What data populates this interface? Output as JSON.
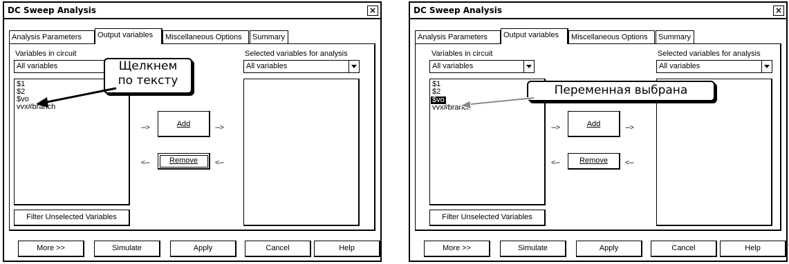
{
  "left_dialog": {
    "title": "DC Sweep Analysis",
    "close": "×",
    "tabs": [
      "Analysis Parameters",
      "Output variables",
      "Miscellaneous Options",
      "Summary"
    ],
    "variables_label": "Variables in circuit",
    "variables_filter": "All variables",
    "variables_list": [
      "$1",
      "$2",
      "$vo",
      "vvx#branch"
    ],
    "selected_label": "Selected variables for analysis",
    "selected_filter": "All variables",
    "add_arrow_left": "--->",
    "add_label": "Add",
    "add_arrow_right": "--->",
    "remove_arrow_left": "<---",
    "remove_label": "Remove",
    "remove_arrow_right": "<---",
    "filter_button": "Filter Unselected Variables",
    "footer_buttons": [
      "More >>",
      "Simulate",
      "Apply",
      "Cancel",
      "Help"
    ],
    "callout": [
      "Щелкнем",
      "по тексту"
    ]
  },
  "right_dialog": {
    "title": "DC Sweep Analysis",
    "close": "×",
    "tabs": [
      "Analysis Parameters",
      "Output variables",
      "Miscellaneous Options",
      "Summary"
    ],
    "variables_label": "Variables in circuit",
    "variables_filter": "All variables",
    "variables_list": [
      "$1",
      "$2",
      "$vo",
      "vvx#branch"
    ],
    "selected_item": "$vo",
    "selected_label": "Selected variables for analysis",
    "selected_filter": "All variables",
    "add_arrow_left": "--->",
    "add_label": "Add",
    "add_arrow_right": "--->",
    "remove_arrow_left": "<---",
    "remove_label": "Remove",
    "remove_arrow_right": "<---",
    "filter_button": "Filter Unselected Variables",
    "footer_buttons": [
      "More >>",
      "Simulate",
      "Apply",
      "Cancel",
      "Help"
    ],
    "callout": "Переменная выбрана"
  }
}
